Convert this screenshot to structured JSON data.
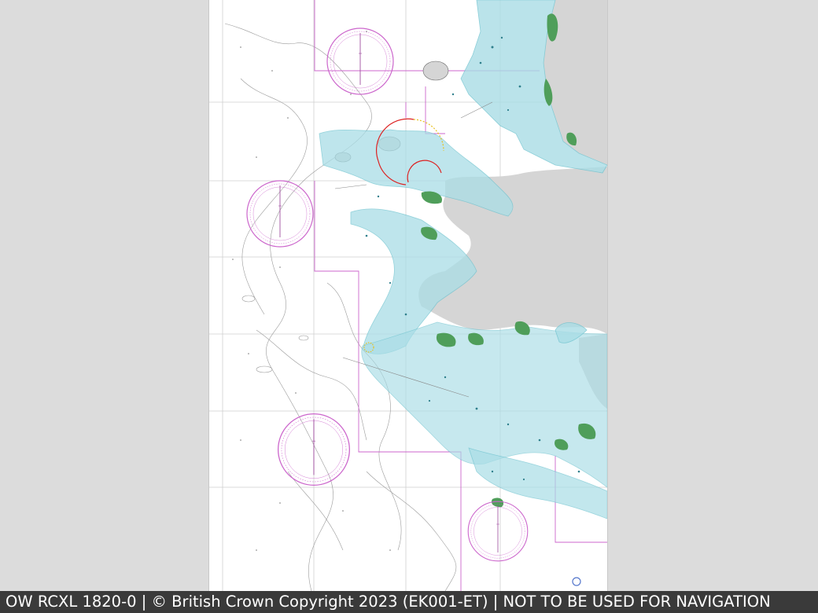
{
  "caption": "OW RCXL 1820-0 | © British Crown Copyright 2023 (EK001-ET) | NOT TO BE USED FOR NAVIGATION",
  "colors": {
    "viewer_background": "#dcdcdc",
    "sea": "#ffffff",
    "land": "#d5d5d5",
    "intertidal": "#4f9e5a",
    "shallow_water": "#a9dde6",
    "shallow_water_dark": "#6fc3cf",
    "depth_contour": "#9a9a9a",
    "magenta_boundary": "#cc66cc",
    "grid_line": "#c8c8c8",
    "caption_background": "#3a3a3a",
    "caption_text": "#ffffff"
  },
  "icons": {
    "compass_rose": "compass-rose-icon",
    "sector_light": "light-sector-icon"
  }
}
